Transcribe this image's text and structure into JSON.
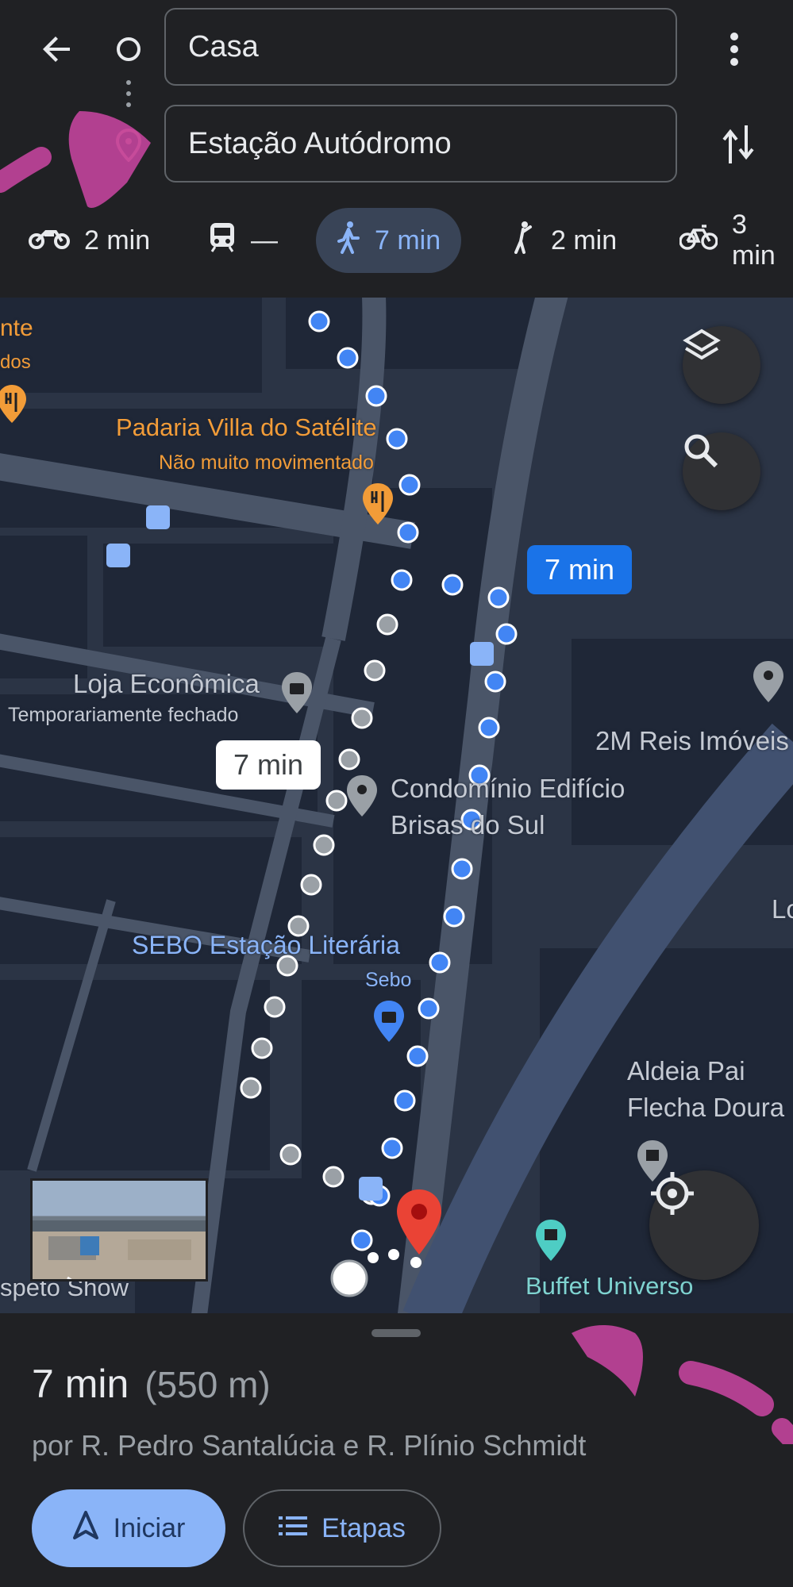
{
  "header": {
    "origin_value": "Casa",
    "destination_value": "Estação Autódromo"
  },
  "modes": [
    {
      "icon": "motorcycle-icon",
      "label": "2 min"
    },
    {
      "icon": "transit-icon",
      "label": "—"
    },
    {
      "icon": "walking-icon",
      "label": "7 min",
      "active": true
    },
    {
      "icon": "ride-service-icon",
      "label": "2 min"
    },
    {
      "icon": "bicycle-icon",
      "label": "3 min"
    }
  ],
  "map": {
    "pois": {
      "partial_top_left_1": "nte",
      "partial_top_left_2": "dos",
      "padaria_name": "Padaria Villa do Satélite",
      "padaria_status": "Não muito movimentado",
      "loja_name": "Loja Econômica",
      "loja_status": "Temporariamente fechado",
      "condominio_line1": "Condomínio Edifício",
      "condominio_line2": "Brisas do Sul",
      "sebo_name": "SEBO Estação Literária",
      "sebo_category": "Sebo",
      "reis_imoveis": "2M Reis Imóveis",
      "aldeia_line1": "Aldeia Pai",
      "aldeia_line2": "Flecha Doura",
      "buffet": "Buffet Universo",
      "espeto": "speto Show",
      "partial_right_1": "Lo"
    },
    "route_bubble_primary": "7 min",
    "route_bubble_alt": "7 min"
  },
  "sheet": {
    "duration": "7 min",
    "distance": "(550 m)",
    "via": "por R. Pedro Santalúcia e R. Plínio Schmidt",
    "start_label": "Iniciar",
    "steps_label": "Etapas"
  },
  "colors": {
    "accent_blue": "#8ab4f8",
    "route_blue": "#4285f4",
    "alt_route_grey": "#9aa0a6",
    "destination_red": "#ea4335",
    "poi_orange": "#f29c38"
  }
}
